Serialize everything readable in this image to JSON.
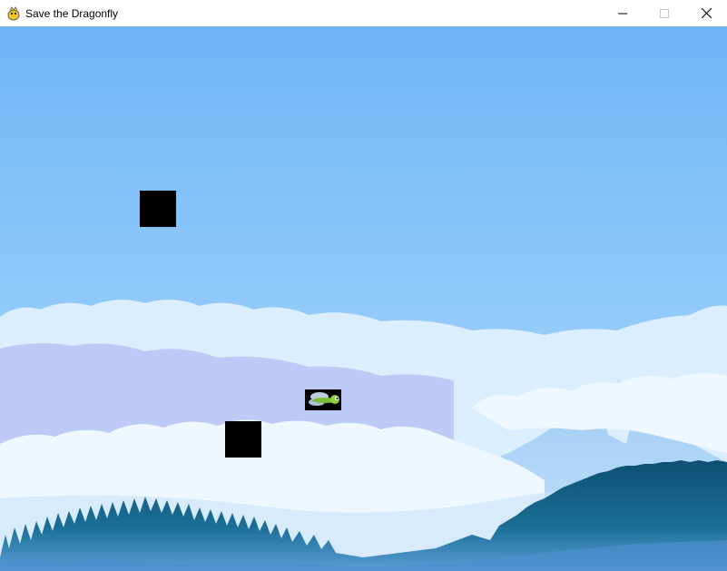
{
  "window": {
    "title": "Save the Dragonfly",
    "app_icon": "pygame-snake-icon",
    "controls": {
      "minimize": "minimize-icon",
      "maximize": "maximize-icon",
      "close": "close-icon"
    }
  },
  "game": {
    "background": {
      "sky_top": "#6db5f7",
      "sky_bottom": "#a8d6fb",
      "cloud_color": "#e4f2fe",
      "cloud_shadow": "#b8c6f4",
      "mountain_color": "#b7dbf9",
      "forest_dark": "#0d4f73",
      "forest_mid": "#1b6f96",
      "forest_light": "#5a9ed6"
    },
    "player": {
      "name": "dragonfly",
      "icon": "dragonfly-sprite"
    },
    "obstacles": [
      {
        "id": "obstacle-1",
        "color": "#000000"
      },
      {
        "id": "obstacle-2",
        "color": "#000000"
      }
    ]
  }
}
